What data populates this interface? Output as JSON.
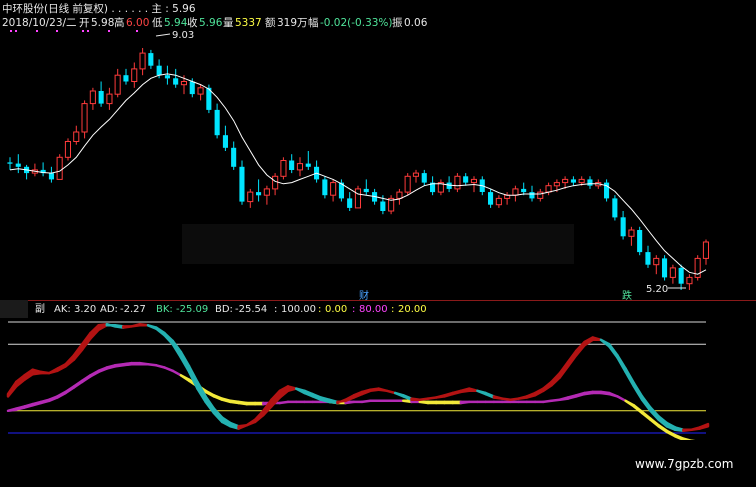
{
  "colors": {
    "bg": "#000000",
    "up": "#ff3b3b",
    "down": "#00e5ff",
    "ma": "#ffffff",
    "ak": "#b31313",
    "ad": "#24b1b1",
    "bk": "#f2e93a",
    "bd": "#b42ab4",
    "level_white": "#d9d9d9",
    "level_yellow": "#f2e93a",
    "level_blue": "#2222ff"
  },
  "header": {
    "line1": "中环股份(日线 前复权) . . . . . . 主 : 5.96",
    "date": "2018/10/23/二",
    "open_label": "开",
    "open": "5.98",
    "high_label": "高",
    "high": "6.00",
    "low_label": "低",
    "low": "5.94",
    "close_label": "收",
    "close": "5.96",
    "vol_label": "量",
    "vol": "5337",
    "amt_label": "额",
    "amt": "319万",
    "change_label": "幅",
    "change": "-0.02(-0.33%)",
    "amp_label": "振",
    "amp": "0.06("
  },
  "price_annotations": {
    "high_label": "9.03",
    "low_label": "5.20",
    "cai": "财",
    "die": "跌"
  },
  "sub": {
    "title": "副",
    "items": [
      {
        "label": "AK:",
        "value": "3.20",
        "color": "#ffffff"
      },
      {
        "label": "AD:",
        "value": "-2.27",
        "color": "#ffffff"
      },
      {
        "label": "BK:",
        "value": "-25.09",
        "color": "#4fe39a"
      },
      {
        "label": "BD:",
        "value": "-25.54",
        "color": "#ffffff"
      },
      {
        "label": ":",
        "value": "100.00",
        "color": "#ffffff"
      },
      {
        "label": ":",
        "value": "0.00",
        "color": "#ffff44"
      },
      {
        "label": ":",
        "value": "80.00",
        "color": "#ff44ff"
      },
      {
        "label": ":",
        "value": "20.00",
        "color": "#ffff44"
      }
    ]
  },
  "watermark": "www.7gpzb.com",
  "chart_data": [
    {
      "type": "candlestick",
      "title": "中环股份(日线 前复权)",
      "price_range": [
        5.2,
        9.03
      ],
      "ohlc": [
        [
          7.22,
          7.3,
          7.1,
          7.2
        ],
        [
          7.2,
          7.35,
          7.05,
          7.15
        ],
        [
          7.15,
          7.18,
          6.95,
          7.05
        ],
        [
          7.05,
          7.2,
          7.0,
          7.1
        ],
        [
          7.1,
          7.22,
          7.0,
          7.05
        ],
        [
          7.05,
          7.15,
          6.9,
          6.95
        ],
        [
          6.95,
          7.35,
          6.95,
          7.3
        ],
        [
          7.3,
          7.6,
          7.25,
          7.55
        ],
        [
          7.55,
          7.8,
          7.5,
          7.7
        ],
        [
          7.7,
          8.2,
          7.6,
          8.15
        ],
        [
          8.15,
          8.4,
          8.05,
          8.35
        ],
        [
          8.35,
          8.5,
          8.1,
          8.15
        ],
        [
          8.15,
          8.4,
          8.05,
          8.3
        ],
        [
          8.3,
          8.7,
          8.25,
          8.6
        ],
        [
          8.6,
          8.7,
          8.45,
          8.5
        ],
        [
          8.5,
          8.8,
          8.4,
          8.7
        ],
        [
          8.7,
          9.03,
          8.6,
          8.95
        ],
        [
          8.95,
          9.0,
          8.7,
          8.75
        ],
        [
          8.75,
          8.85,
          8.55,
          8.6
        ],
        [
          8.6,
          8.75,
          8.45,
          8.55
        ],
        [
          8.55,
          8.7,
          8.4,
          8.45
        ],
        [
          8.45,
          8.6,
          8.3,
          8.5
        ],
        [
          8.5,
          8.55,
          8.25,
          8.3
        ],
        [
          8.3,
          8.45,
          8.2,
          8.4
        ],
        [
          8.4,
          8.45,
          8.0,
          8.05
        ],
        [
          8.05,
          8.15,
          7.6,
          7.65
        ],
        [
          7.65,
          7.8,
          7.4,
          7.45
        ],
        [
          7.45,
          7.55,
          7.1,
          7.15
        ],
        [
          7.15,
          7.25,
          6.55,
          6.6
        ],
        [
          6.6,
          6.8,
          6.5,
          6.75
        ],
        [
          6.75,
          6.95,
          6.6,
          6.7
        ],
        [
          6.7,
          6.85,
          6.55,
          6.8
        ],
        [
          6.8,
          7.05,
          6.7,
          7.0
        ],
        [
          7.0,
          7.3,
          6.95,
          7.25
        ],
        [
          7.25,
          7.35,
          7.05,
          7.1
        ],
        [
          7.1,
          7.3,
          7.0,
          7.2
        ],
        [
          7.2,
          7.4,
          7.1,
          7.15
        ],
        [
          7.15,
          7.25,
          6.9,
          6.95
        ],
        [
          6.95,
          7.0,
          6.65,
          6.7
        ],
        [
          6.7,
          6.95,
          6.6,
          6.9
        ],
        [
          6.9,
          6.95,
          6.6,
          6.65
        ],
        [
          6.65,
          6.75,
          6.45,
          6.5
        ],
        [
          6.5,
          6.85,
          6.5,
          6.8
        ],
        [
          6.8,
          6.95,
          6.7,
          6.75
        ],
        [
          6.75,
          6.8,
          6.55,
          6.6
        ],
        [
          6.6,
          6.7,
          6.4,
          6.45
        ],
        [
          6.45,
          6.7,
          6.4,
          6.65
        ],
        [
          6.65,
          6.8,
          6.55,
          6.75
        ],
        [
          6.75,
          7.05,
          6.7,
          7.0
        ],
        [
          7.0,
          7.1,
          6.9,
          7.05
        ],
        [
          7.05,
          7.1,
          6.85,
          6.9
        ],
        [
          6.9,
          7.0,
          6.7,
          6.75
        ],
        [
          6.75,
          6.95,
          6.7,
          6.9
        ],
        [
          6.9,
          7.0,
          6.75,
          6.8
        ],
        [
          6.8,
          7.05,
          6.75,
          7.0
        ],
        [
          7.0,
          7.05,
          6.85,
          6.9
        ],
        [
          6.9,
          7.0,
          6.75,
          6.95
        ],
        [
          6.95,
          7.0,
          6.7,
          6.75
        ],
        [
          6.75,
          6.8,
          6.5,
          6.55
        ],
        [
          6.55,
          6.7,
          6.5,
          6.65
        ],
        [
          6.65,
          6.75,
          6.55,
          6.7
        ],
        [
          6.7,
          6.85,
          6.6,
          6.8
        ],
        [
          6.8,
          6.9,
          6.7,
          6.75
        ],
        [
          6.75,
          6.85,
          6.6,
          6.65
        ],
        [
          6.65,
          6.8,
          6.6,
          6.75
        ],
        [
          6.75,
          6.9,
          6.7,
          6.85
        ],
        [
          6.85,
          6.95,
          6.75,
          6.9
        ],
        [
          6.9,
          7.0,
          6.8,
          6.95
        ],
        [
          6.95,
          7.0,
          6.85,
          6.9
        ],
        [
          6.9,
          7.0,
          6.85,
          6.95
        ],
        [
          6.95,
          7.0,
          6.8,
          6.85
        ],
        [
          6.85,
          6.95,
          6.8,
          6.9
        ],
        [
          6.9,
          6.95,
          6.6,
          6.65
        ],
        [
          6.65,
          6.7,
          6.3,
          6.35
        ],
        [
          6.35,
          6.45,
          6.0,
          6.05
        ],
        [
          6.05,
          6.2,
          5.9,
          6.15
        ],
        [
          6.15,
          6.2,
          5.75,
          5.8
        ],
        [
          5.8,
          5.9,
          5.55,
          5.6
        ],
        [
          5.6,
          5.75,
          5.45,
          5.7
        ],
        [
          5.7,
          5.75,
          5.35,
          5.4
        ],
        [
          5.4,
          5.6,
          5.3,
          5.55
        ],
        [
          5.55,
          5.6,
          5.2,
          5.3
        ],
        [
          5.3,
          5.45,
          5.2,
          5.4
        ],
        [
          5.4,
          5.75,
          5.35,
          5.7
        ],
        [
          5.7,
          6.0,
          5.6,
          5.96
        ]
      ],
      "ma": [
        7.1,
        7.12,
        7.1,
        7.08,
        7.06,
        7.05,
        7.08,
        7.18,
        7.3,
        7.48,
        7.65,
        7.78,
        7.9,
        8.05,
        8.2,
        8.32,
        8.45,
        8.55,
        8.6,
        8.62,
        8.6,
        8.55,
        8.5,
        8.45,
        8.38,
        8.25,
        8.08,
        7.88,
        7.62,
        7.4,
        7.18,
        7.02,
        6.92,
        6.88,
        6.9,
        6.95,
        7.0,
        7.05,
        7.0,
        6.95,
        6.88,
        6.8,
        6.72,
        6.7,
        6.68,
        6.65,
        6.62,
        6.64,
        6.7,
        6.78,
        6.85,
        6.88,
        6.88,
        6.86,
        6.85,
        6.86,
        6.87,
        6.85,
        6.8,
        6.74,
        6.7,
        6.7,
        6.72,
        6.72,
        6.72,
        6.75,
        6.78,
        6.82,
        6.85,
        6.87,
        6.88,
        6.88,
        6.85,
        6.76,
        6.62,
        6.48,
        6.32,
        6.15,
        5.98,
        5.82,
        5.7,
        5.58,
        5.48,
        5.45,
        5.52
      ]
    },
    {
      "type": "line",
      "title": "副",
      "ylim": [
        -10,
        105
      ],
      "levels": [
        100,
        80,
        20,
        0
      ],
      "series": [
        {
          "name": "AK",
          "values": [
            35,
            46,
            52,
            57,
            55,
            54,
            58,
            62,
            70,
            80,
            90,
            97,
            98,
            96,
            95,
            96,
            98,
            97,
            94,
            88,
            80,
            68,
            55,
            40,
            28,
            18,
            10,
            6,
            4,
            7,
            12,
            20,
            30,
            38,
            42,
            40,
            36,
            33,
            30,
            28,
            27,
            30,
            34,
            37,
            39,
            40,
            38,
            36,
            33,
            30,
            30,
            31,
            32,
            34,
            36,
            38,
            40,
            38,
            35,
            32,
            31,
            30,
            31,
            33,
            36,
            40,
            46,
            54,
            64,
            74,
            82,
            86,
            84,
            78,
            68,
            55,
            42,
            30,
            20,
            12,
            6,
            3,
            2,
            3,
            5,
            8
          ]
        },
        {
          "name": "AD",
          "values": [
            33,
            42,
            48,
            53,
            54,
            54,
            56,
            60,
            66,
            75,
            85,
            93,
            97,
            97,
            96,
            96,
            97,
            97,
            95,
            90,
            83,
            73,
            60,
            46,
            33,
            22,
            14,
            9,
            6,
            7,
            10,
            16,
            24,
            32,
            38,
            40,
            38,
            35,
            32,
            30,
            28,
            29,
            32,
            35,
            38,
            39,
            38,
            36,
            34,
            31,
            30,
            31,
            32,
            33,
            35,
            37,
            38,
            38,
            36,
            33,
            31,
            30,
            31,
            32,
            34,
            38,
            43,
            50,
            60,
            70,
            79,
            84,
            84,
            80,
            70,
            58,
            45,
            33,
            23,
            15,
            9,
            5,
            3,
            3,
            4,
            6
          ]
        },
        {
          "name": "BK",
          "values": [
            20,
            22,
            24,
            26,
            28,
            30,
            33,
            37,
            42,
            47,
            52,
            56,
            59,
            61,
            62,
            63,
            63,
            62,
            61,
            59,
            56,
            52,
            47,
            42,
            37,
            33,
            30,
            28,
            27,
            26,
            26,
            26,
            27,
            27,
            28,
            28,
            28,
            28,
            28,
            28,
            27,
            27,
            28,
            28,
            29,
            29,
            29,
            29,
            29,
            28,
            28,
            27,
            27,
            27,
            27,
            27,
            28,
            28,
            28,
            28,
            28,
            28,
            28,
            28,
            28,
            28,
            29,
            30,
            32,
            34,
            36,
            37,
            37,
            36,
            33,
            29,
            24,
            18,
            12,
            6,
            1,
            -3,
            -6,
            -8,
            -9,
            -9
          ]
        },
        {
          "name": "BD",
          "values": [
            20,
            21,
            23,
            25,
            27,
            29,
            32,
            36,
            41,
            46,
            51,
            55,
            58,
            60,
            61,
            62,
            62,
            62,
            61,
            59,
            56,
            52,
            48,
            43,
            38,
            34,
            31,
            29,
            28,
            27,
            27,
            27,
            27,
            27,
            28,
            28,
            28,
            28,
            28,
            28,
            28,
            28,
            28,
            28,
            29,
            29,
            29,
            29,
            29,
            29,
            28,
            28,
            28,
            28,
            28,
            28,
            28,
            28,
            28,
            28,
            28,
            28,
            28,
            28,
            28,
            28,
            29,
            30,
            31,
            33,
            35,
            36,
            36,
            35,
            33,
            29,
            25,
            19,
            13,
            7,
            2,
            -2,
            -5,
            -7,
            -8,
            -9
          ]
        }
      ]
    }
  ]
}
